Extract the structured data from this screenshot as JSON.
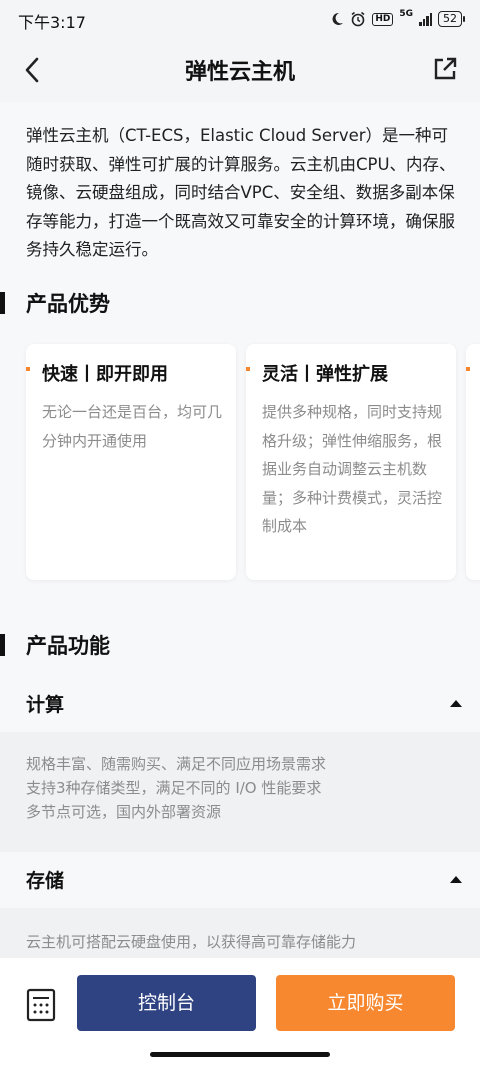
{
  "status": {
    "time": "下午3:17",
    "network": "5G",
    "hd": "HD",
    "battery": "52"
  },
  "nav": {
    "title": "弹性云主机"
  },
  "intro": "弹性云主机（CT-ECS，Elastic Cloud Server）是一种可随时获取、弹性可扩展的计算服务。云主机由CPU、内存、镜像、云硬盘组成，同时结合VPC、安全组、数据多副本保存等能力，打造一个既高效又可靠安全的计算环境，确保服务持久稳定运行。",
  "advantages": {
    "title": "产品优势",
    "cards": [
      {
        "title": "快速丨即开即用",
        "desc": "无论一台还是百台，均可几分钟内开通使用"
      },
      {
        "title": "灵活丨弹性扩展",
        "desc": "提供多种规格，同时支持规格升级；弹性伸缩服务，根据业务自动调整云主机数量；多种计费模式，灵活控制成本"
      }
    ]
  },
  "features": {
    "title": "产品功能",
    "sections": [
      {
        "label": "计算",
        "lines": [
          "规格丰富、随需购买、满足不同应用场景需求",
          "支持3种存储类型，满足不同的 I/O 性能要求",
          "多节点可选，国内外部署资源"
        ]
      },
      {
        "label": "存储",
        "lines": [
          "云主机可搭配云硬盘使用，以获得高可靠存储能力"
        ]
      }
    ]
  },
  "bottom": {
    "console_label": "控制台",
    "buy_label": "立即购买"
  },
  "colors": {
    "accent_orange": "#f78830",
    "console_blue": "#2f4282"
  },
  "icons": [
    "back-icon",
    "share-icon",
    "calculator-icon",
    "alarm-icon",
    "moon-icon",
    "collapse-arrow-icon"
  ]
}
